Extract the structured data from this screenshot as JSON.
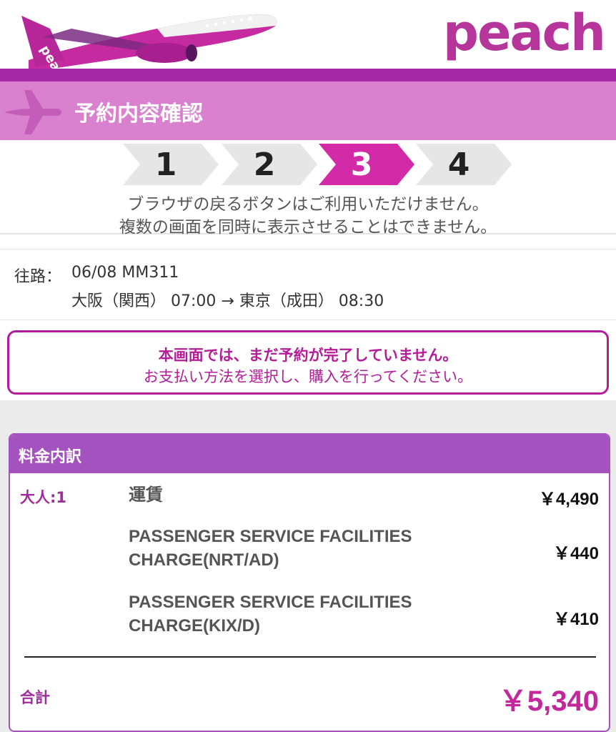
{
  "header": {
    "logo_text": "peach",
    "logo_color": "#b5359a",
    "bar_color": "#a52aa8"
  },
  "title_band": {
    "title": "予約内容確認",
    "icon": "airplane-icon",
    "background": "#d981cf"
  },
  "steps": [
    {
      "label": "1",
      "active": false
    },
    {
      "label": "2",
      "active": false
    },
    {
      "label": "3",
      "active": true
    },
    {
      "label": "4",
      "active": false
    }
  ],
  "notice": {
    "line1": "ブラウザの戻るボタンはご利用いただけません。",
    "line2": "複数の画面を同時に表示させることはできません。"
  },
  "flight": {
    "label": "往路：",
    "date_flight": "06/08  MM311",
    "route": "大阪（関西） 07:00 → 東京（成田） 08:30"
  },
  "warning": {
    "line1": "本画面では、まだ予約が完了していません。",
    "line2": "お支払い方法を選択し、購入を行ってください。",
    "color": "#b41d97"
  },
  "fare": {
    "header": "料金内訳",
    "passenger": "大人:1",
    "items": [
      {
        "name": "運賃",
        "amount": "￥4,490"
      },
      {
        "name": "PASSENGER SERVICE FACILITIES CHARGE(NRT/AD)",
        "amount": "￥440"
      },
      {
        "name": "PASSENGER SERVICE FACILITIES CHARGE(KIX/D)",
        "amount": "￥410"
      }
    ],
    "total_label": "合計",
    "total_amount": "￥5,340",
    "accent": "#a452bf"
  }
}
